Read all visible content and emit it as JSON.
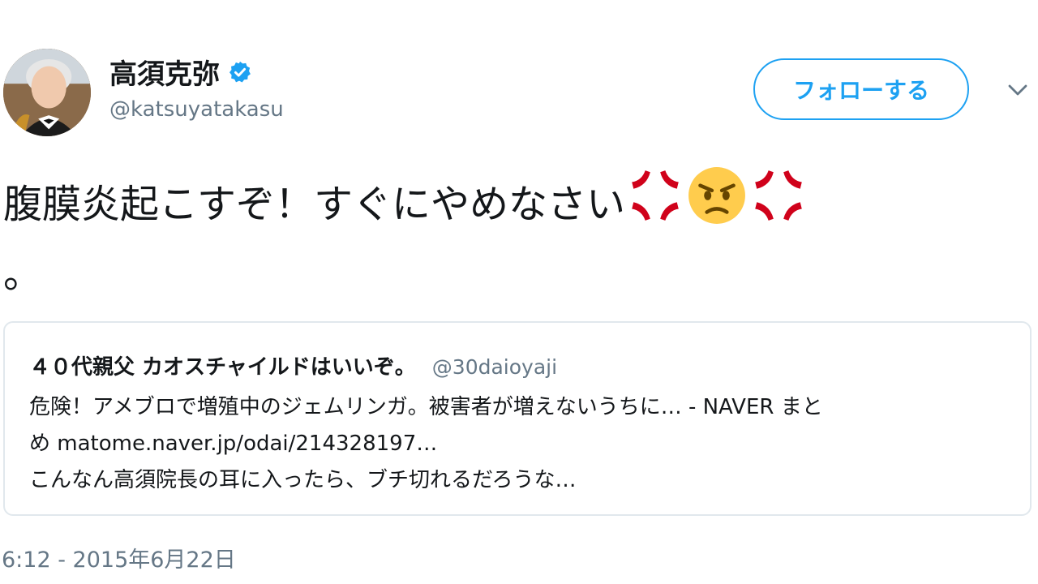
{
  "author": {
    "display_name": "高須克弥",
    "handle": "@katsuyatakasu",
    "verified": true
  },
  "actions": {
    "follow_label": "フォローする",
    "menu_icon": "chevron-down-icon"
  },
  "tweet": {
    "text_main": "腹膜炎起こすぞ！すぐにやめなさい",
    "text_tail": "。",
    "emojis": [
      "anger-symbol-icon",
      "angry-face-icon",
      "anger-symbol-icon"
    ]
  },
  "quote": {
    "display_name": "４０代親父 カオスチャイルドはいいぞ。",
    "handle": "@30daioyaji",
    "lines": [
      "危険！アメブロで増殖中のジェムリンガ。被害者が増えないうちに… - NAVER まと",
      "め matome.naver.jp/odai/214328197…",
      "こんなん高須院長の耳に入ったら、ブチ切れるだろうな…"
    ]
  },
  "timestamp": "6:12 - 2015年6月22日",
  "colors": {
    "accent": "#1da1f2",
    "muted": "#657786",
    "text": "#14171a",
    "border": "#e1e8ed",
    "anger": "#d0021b",
    "emoji_face": "#ffcc4d"
  }
}
